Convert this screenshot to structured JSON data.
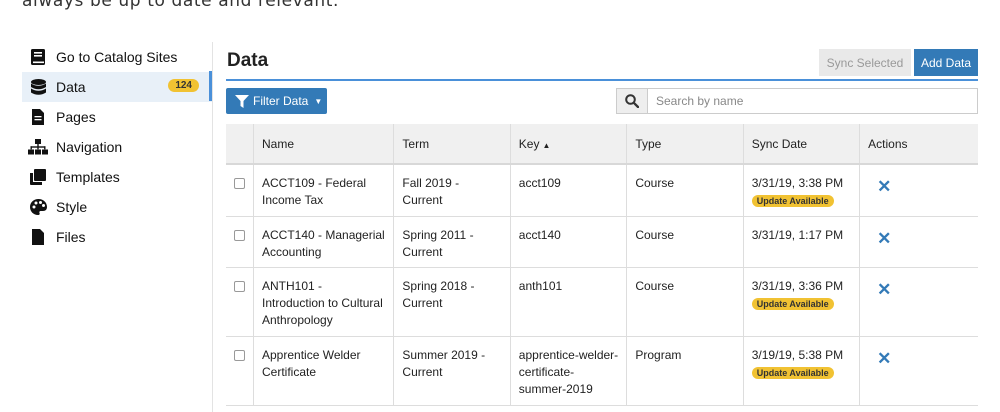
{
  "intro_text": "always be up to date and relevant.",
  "sidebar": {
    "items": [
      {
        "label": "Go to Catalog Sites",
        "icon": "book-icon"
      },
      {
        "label": "Data",
        "icon": "database-icon",
        "badge": "124"
      },
      {
        "label": "Pages",
        "icon": "file-icon"
      },
      {
        "label": "Navigation",
        "icon": "sitemap-icon"
      },
      {
        "label": "Templates",
        "icon": "clone-icon"
      },
      {
        "label": "Style",
        "icon": "palette-icon"
      },
      {
        "label": "Files",
        "icon": "file-icon"
      }
    ]
  },
  "main": {
    "title": "Data",
    "sync_selected_label": "Sync Selected",
    "add_data_label": "Add Data",
    "filter_label": "Filter Data",
    "search_placeholder": "Search by name",
    "table": {
      "headers": [
        "Name",
        "Term",
        "Key",
        "Type",
        "Sync Date",
        "Actions"
      ],
      "update_badge": "Update Available",
      "rows": [
        {
          "name": "ACCT109 - Federal Income Tax",
          "term": "Fall 2019 - Current",
          "key": "acct109",
          "type": "Course",
          "sync_date": "3/31/19, 3:38 PM",
          "update": true
        },
        {
          "name": "ACCT140 - Managerial Accounting",
          "term": "Spring 2011 - Current",
          "key": "acct140",
          "type": "Course",
          "sync_date": "3/31/19, 1:17 PM",
          "update": false
        },
        {
          "name": "ANTH101 - Introduction to Cultural Anthropology",
          "term": "Spring 2018 - Current",
          "key": "anth101",
          "type": "Course",
          "sync_date": "3/31/19, 3:36 PM",
          "update": true
        },
        {
          "name": "Apprentice Welder Certificate",
          "term": "Summer 2019 - Current",
          "key": "apprentice-welder-certificate-summer-2019",
          "type": "Program",
          "sync_date": "3/19/19, 5:38 PM",
          "update": true
        }
      ]
    }
  },
  "colors": {
    "primary": "#337ab7",
    "badge": "#f1c232",
    "active_bg": "#e8f0f8"
  }
}
